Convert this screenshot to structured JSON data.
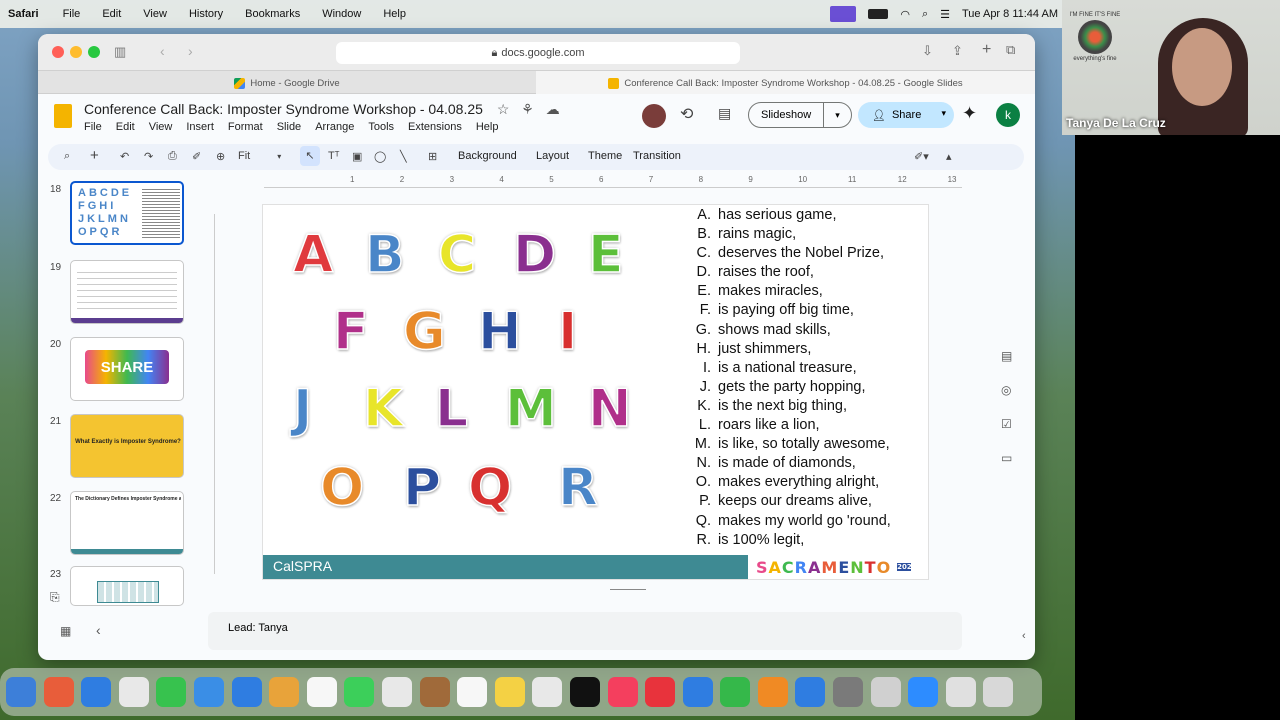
{
  "menubar": {
    "app": "Safari",
    "items": [
      "File",
      "Edit",
      "View",
      "History",
      "Bookmarks",
      "Window",
      "Help"
    ],
    "clock": "Tue Apr 8  11:44 AM"
  },
  "browser": {
    "url": "docs.google.com",
    "tabs": [
      {
        "label": "Home - Google Drive"
      },
      {
        "label": "Conference Call Back: Imposter Syndrome Workshop - 04.08.25 - Google Slides"
      }
    ]
  },
  "doc": {
    "title": "Conference Call Back: Imposter Syndrome Workshop - 04.08.25",
    "menu": [
      "File",
      "Edit",
      "View",
      "Insert",
      "Format",
      "Slide",
      "Arrange",
      "Tools",
      "Extensions",
      "Help"
    ],
    "slideshow_label": "Slideshow",
    "share_label": "Share",
    "avatar_letter": "k"
  },
  "toolbar": {
    "zoom": "Fit",
    "background": "Background",
    "layout": "Layout",
    "theme": "Theme",
    "transition": "Transition"
  },
  "ruler": [
    "1",
    "2",
    "3",
    "4",
    "5",
    "6",
    "7",
    "8",
    "9",
    "10",
    "11",
    "12",
    "13"
  ],
  "filmstrip": [
    {
      "num": "18"
    },
    {
      "num": "19"
    },
    {
      "num": "20",
      "text": "SHARE"
    },
    {
      "num": "21",
      "text": "What Exactly is Imposter Syndrome?"
    },
    {
      "num": "22",
      "text": "The Dictionary Defines Imposter Syndrome as..."
    },
    {
      "num": "23"
    }
  ],
  "slide": {
    "letters": [
      {
        "ch": "A",
        "color": "#e03a3e"
      },
      {
        "ch": "B",
        "color": "#4a86c8"
      },
      {
        "ch": "C",
        "color": "#e8e52a"
      },
      {
        "ch": "D",
        "color": "#8a2f8f"
      },
      {
        "ch": "E",
        "color": "#5cbf3a"
      },
      {
        "ch": "F",
        "color": "#b0308a"
      },
      {
        "ch": "G",
        "color": "#e88a2a"
      },
      {
        "ch": "H",
        "color": "#2c4f9e"
      },
      {
        "ch": "I",
        "color": "#d8302f"
      },
      {
        "ch": "J",
        "color": "#4a86c8"
      },
      {
        "ch": "K",
        "color": "#e8e52a"
      },
      {
        "ch": "L",
        "color": "#8a2f8f"
      },
      {
        "ch": "M",
        "color": "#5cbf3a"
      },
      {
        "ch": "N",
        "color": "#b0308a"
      },
      {
        "ch": "O",
        "color": "#e88a2a"
      },
      {
        "ch": "P",
        "color": "#2c4f9e"
      },
      {
        "ch": "Q",
        "color": "#d8302f"
      },
      {
        "ch": "R",
        "color": "#4a86c8"
      }
    ],
    "lines": [
      {
        "k": "A.",
        "v": "has serious game,"
      },
      {
        "k": "B.",
        "v": "rains magic,"
      },
      {
        "k": "C.",
        "v": "deserves the Nobel Prize,"
      },
      {
        "k": "D.",
        "v": "raises the roof,"
      },
      {
        "k": "E.",
        "v": "makes miracles,"
      },
      {
        "k": "F.",
        "v": "is paying off big time,"
      },
      {
        "k": "G.",
        "v": "shows mad skills,"
      },
      {
        "k": "H.",
        "v": "just shimmers,"
      },
      {
        "k": "I.",
        "v": "is a national treasure,"
      },
      {
        "k": "J.",
        "v": "gets the party hopping,"
      },
      {
        "k": "K.",
        "v": "is the next big thing,"
      },
      {
        "k": "L.",
        "v": "roars like a lion,"
      },
      {
        "k": "M.",
        "v": "is like, so totally awesome,"
      },
      {
        "k": "N.",
        "v": "is made of diamonds,"
      },
      {
        "k": "O.",
        "v": "makes everything alright,"
      },
      {
        "k": "P.",
        "v": "keeps our dreams alive,"
      },
      {
        "k": "Q.",
        "v": "makes my world go 'round,"
      },
      {
        "k": "R.",
        "v": "is 100% legit,"
      }
    ],
    "banner_left": "CalSPRA",
    "banner_right": "SACRAMENTO",
    "banner_badge": "2024"
  },
  "notes": "Lead: Tanya",
  "video": {
    "name": "Tanya De La Cruz",
    "sign_top": "I'M FINE IT'S FINE",
    "sign_bottom": "everything's fine"
  },
  "dock_colors": [
    "#3d7fd9",
    "#e85d3a",
    "#2f7de1",
    "#e8e8e8",
    "#37c24e",
    "#3a8ee6",
    "#2f7de1",
    "#e8a33a",
    "#f7f7f7",
    "#3ccf5a",
    "#e8e8e8",
    "#a06a3a",
    "#f7f7f7",
    "#f4d144",
    "#e8e8e8",
    "#111111",
    "#f43f5e",
    "#e8333c",
    "#2f7de1",
    "#35b84a",
    "#f08a24",
    "#2f7de1",
    "#7a7a7a",
    "#d0d0d0",
    "#2d8cff",
    "#e0e0e0",
    "#d8d8d8"
  ]
}
